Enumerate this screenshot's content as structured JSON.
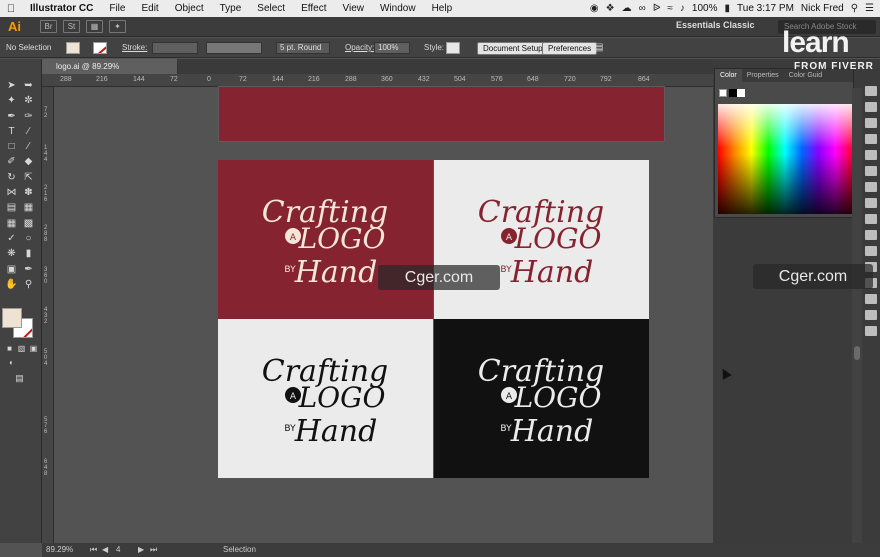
{
  "menubar": {
    "app_name": "Illustrator CC",
    "items": [
      "File",
      "Edit",
      "Object",
      "Type",
      "Select",
      "Effect",
      "View",
      "Window",
      "Help"
    ],
    "status": {
      "battery": "100%",
      "clock": "Tue 3:17 PM",
      "user": "Nick Fred"
    }
  },
  "appbar": {
    "app_logo": "Ai",
    "bridge": "Br",
    "stock": "St",
    "workspace": "Essentials Classic",
    "search_placeholder": "Search Adobe Stock"
  },
  "controlbar": {
    "selection": "No Selection",
    "stroke_label": "Stroke:",
    "brush": "5 pt. Round",
    "opacity_label": "Opacity:",
    "opacity_value": "100%",
    "style_label": "Style:",
    "document_setup": "Document Setup",
    "preferences": "Preferences"
  },
  "document": {
    "tab_title": "logo.ai @ 89.29% (CMYK/Preview)"
  },
  "rulers": {
    "h_ticks": [
      "288",
      "216",
      "144",
      "72",
      "0",
      "72",
      "144",
      "216",
      "288",
      "360",
      "432",
      "504",
      "576",
      "648",
      "720",
      "792",
      "864"
    ],
    "v_ticks": [
      "72",
      "144",
      "216",
      "288",
      "360",
      "432",
      "504",
      "576",
      "648"
    ]
  },
  "color_panel": {
    "tabs": [
      "Color",
      "Properties",
      "Color Guid"
    ]
  },
  "artwork": {
    "words": {
      "line1": "Crafting",
      "badge": "A",
      "line2": "LOGO",
      "small": "BY",
      "line3": "Hand"
    },
    "colors": {
      "maroon": "#862330",
      "cream": "#f2e6d8",
      "light": "#ebebeb",
      "dark": "#111111"
    }
  },
  "statusbar": {
    "zoom": "89.29%",
    "artboard": "4",
    "tool": "Selection"
  },
  "watermarks": {
    "left": "Cger.com",
    "right": "Cger.com",
    "brand": "learn",
    "brand_sub": "FROM FIVERR"
  }
}
